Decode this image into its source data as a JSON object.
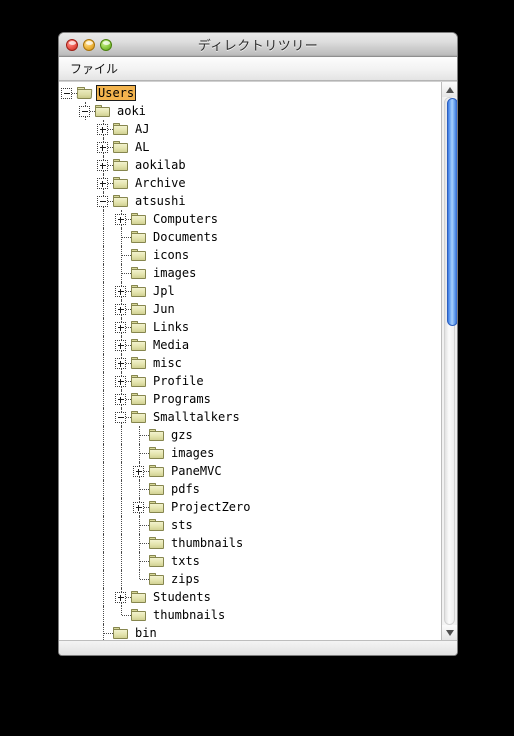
{
  "window": {
    "title": "ディレクトリツリー",
    "traffic_lights": [
      {
        "name": "close",
        "color": "#ef5f54"
      },
      {
        "name": "minimize",
        "color": "#f3bc47"
      },
      {
        "name": "zoom",
        "color": "#94d14c"
      }
    ]
  },
  "menubar": {
    "items": [
      {
        "label": "ファイル"
      }
    ]
  },
  "scrollbar": {
    "up_arrow": "▲",
    "down_arrow": "▼"
  },
  "tree": {
    "selected": "Users",
    "nodes": [
      {
        "label": "Users",
        "depth": 0,
        "state": "expanded",
        "icon": "open-folder-icon",
        "last": true,
        "selected": true
      },
      {
        "label": "aoki",
        "depth": 1,
        "state": "expanded",
        "icon": "folder-icon",
        "last": false,
        "selected": false
      },
      {
        "label": "AJ",
        "depth": 2,
        "state": "collapsed",
        "icon": "folder-icon",
        "last": false,
        "selected": false
      },
      {
        "label": "AL",
        "depth": 2,
        "state": "collapsed",
        "icon": "folder-icon",
        "last": false,
        "selected": false
      },
      {
        "label": "aokilab",
        "depth": 2,
        "state": "collapsed",
        "icon": "folder-icon",
        "last": false,
        "selected": false
      },
      {
        "label": "Archive",
        "depth": 2,
        "state": "collapsed",
        "icon": "folder-icon",
        "last": false,
        "selected": false
      },
      {
        "label": "atsushi",
        "depth": 2,
        "state": "expanded",
        "icon": "folder-icon",
        "last": false,
        "selected": false
      },
      {
        "label": "Computers",
        "depth": 3,
        "state": "collapsed",
        "icon": "folder-icon",
        "last": false,
        "selected": false
      },
      {
        "label": "Documents",
        "depth": 3,
        "state": "leaf",
        "icon": "folder-icon",
        "last": false,
        "selected": false
      },
      {
        "label": "icons",
        "depth": 3,
        "state": "leaf",
        "icon": "folder-icon",
        "last": false,
        "selected": false
      },
      {
        "label": "images",
        "depth": 3,
        "state": "leaf",
        "icon": "folder-icon",
        "last": false,
        "selected": false
      },
      {
        "label": "Jpl",
        "depth": 3,
        "state": "collapsed",
        "icon": "folder-icon",
        "last": false,
        "selected": false
      },
      {
        "label": "Jun",
        "depth": 3,
        "state": "collapsed",
        "icon": "folder-icon",
        "last": false,
        "selected": false
      },
      {
        "label": "Links",
        "depth": 3,
        "state": "collapsed",
        "icon": "folder-icon",
        "last": false,
        "selected": false
      },
      {
        "label": "Media",
        "depth": 3,
        "state": "collapsed",
        "icon": "folder-icon",
        "last": false,
        "selected": false
      },
      {
        "label": "misc",
        "depth": 3,
        "state": "collapsed",
        "icon": "folder-icon",
        "last": false,
        "selected": false
      },
      {
        "label": "Profile",
        "depth": 3,
        "state": "collapsed",
        "icon": "folder-icon",
        "last": false,
        "selected": false
      },
      {
        "label": "Programs",
        "depth": 3,
        "state": "collapsed",
        "icon": "folder-icon",
        "last": false,
        "selected": false
      },
      {
        "label": "Smalltalkers",
        "depth": 3,
        "state": "expanded",
        "icon": "folder-icon",
        "last": false,
        "selected": false
      },
      {
        "label": "gzs",
        "depth": 4,
        "state": "leaf",
        "icon": "folder-icon",
        "last": false,
        "selected": false
      },
      {
        "label": "images",
        "depth": 4,
        "state": "leaf",
        "icon": "folder-icon",
        "last": false,
        "selected": false
      },
      {
        "label": "PaneMVC",
        "depth": 4,
        "state": "collapsed",
        "icon": "folder-icon",
        "last": false,
        "selected": false
      },
      {
        "label": "pdfs",
        "depth": 4,
        "state": "leaf",
        "icon": "folder-icon",
        "last": false,
        "selected": false
      },
      {
        "label": "ProjectZero",
        "depth": 4,
        "state": "collapsed",
        "icon": "folder-icon",
        "last": false,
        "selected": false
      },
      {
        "label": "sts",
        "depth": 4,
        "state": "leaf",
        "icon": "folder-icon",
        "last": false,
        "selected": false
      },
      {
        "label": "thumbnails",
        "depth": 4,
        "state": "leaf",
        "icon": "folder-icon",
        "last": false,
        "selected": false
      },
      {
        "label": "txts",
        "depth": 4,
        "state": "leaf",
        "icon": "folder-icon",
        "last": false,
        "selected": false
      },
      {
        "label": "zips",
        "depth": 4,
        "state": "leaf",
        "icon": "folder-icon",
        "last": true,
        "selected": false
      },
      {
        "label": "Students",
        "depth": 3,
        "state": "collapsed",
        "icon": "folder-icon",
        "last": false,
        "selected": false
      },
      {
        "label": "thumbnails",
        "depth": 3,
        "state": "leaf",
        "icon": "folder-icon",
        "last": true,
        "selected": false
      },
      {
        "label": "bin",
        "depth": 2,
        "state": "leaf",
        "icon": "folder-icon",
        "last": false,
        "selected": false
      }
    ]
  }
}
